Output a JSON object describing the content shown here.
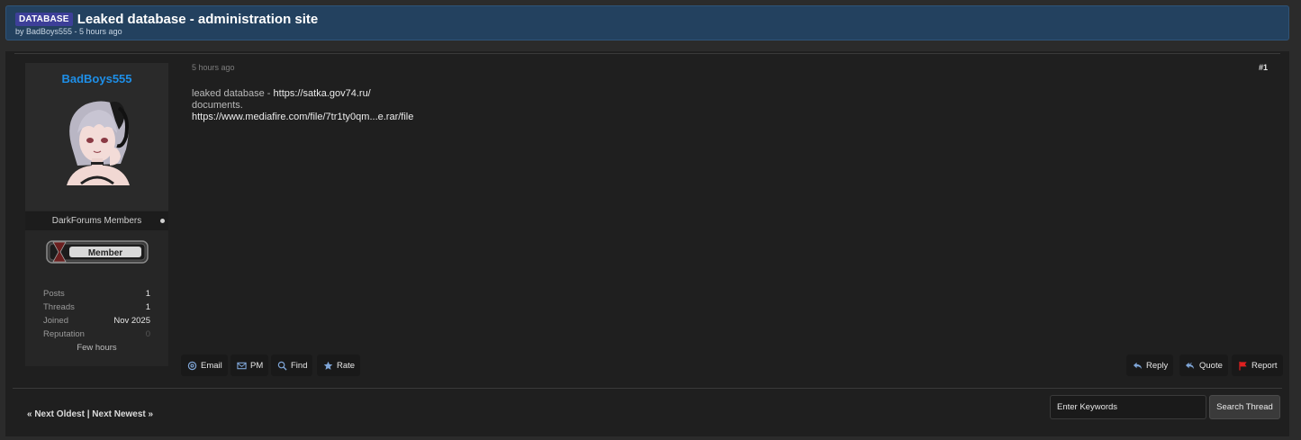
{
  "thread": {
    "prefix": "DATABASE",
    "title": "Leaked database - administration site",
    "meta": "by BadBoys555 - 5 hours ago"
  },
  "author": {
    "username": "BadBoys555",
    "usergroup": "DarkForums Members",
    "rank_label": "Member",
    "stats": [
      {
        "label": "Posts",
        "value": "1"
      },
      {
        "label": "Threads",
        "value": "1"
      },
      {
        "label": "Joined",
        "value": "Nov 2025"
      },
      {
        "label": "Reputation",
        "value": "0"
      }
    ],
    "last_active": "Few hours"
  },
  "post": {
    "date": "5 hours ago",
    "number": "#1",
    "line1_text": "leaked database - ",
    "line1_link": "https://satka.gov74.ru/",
    "line2_text": "documents.",
    "line3_link": "https://www.mediafire.com/file/7tr1ty0qm...e.rar/file"
  },
  "buttons": {
    "left": [
      {
        "label": "Email",
        "icon": "at-icon"
      },
      {
        "label": "PM",
        "icon": "envelope-icon"
      },
      {
        "label": "Find",
        "icon": "search-icon"
      },
      {
        "label": "Rate",
        "icon": "star-icon"
      }
    ],
    "right": [
      {
        "label": "Reply",
        "icon": "reply-icon"
      },
      {
        "label": "Quote",
        "icon": "quote-icon"
      },
      {
        "label": "Report",
        "icon": "flag-icon"
      }
    ]
  },
  "footer": {
    "next_oldest": "« Next Oldest",
    "separator": "|",
    "next_newest": "Next Newest »",
    "search_placeholder": "Enter Keywords",
    "search_button": "Search Thread"
  },
  "colors": {
    "header_bg": "#23415f",
    "username": "#1e8fe8",
    "prefix_badge": "#3d3f99",
    "report_flag": "#e02020",
    "icon_blue": "#7fa6d8"
  }
}
